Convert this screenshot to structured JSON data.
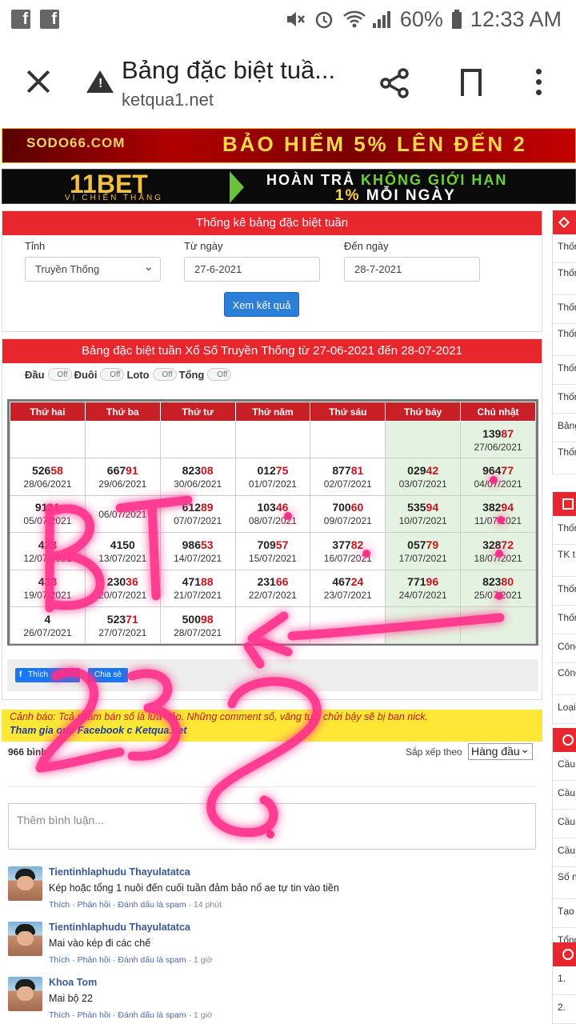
{
  "status_bar": {
    "fb_icon": "f",
    "battery": "60%",
    "time": "12:33 AM"
  },
  "browser": {
    "title": "Bảng đặc biệt tuầ...",
    "url": "ketqua1.net"
  },
  "banners": {
    "b1_logo": "SODO66.COM",
    "b1_text": "BẢO HIỂM 5% LÊN ĐẾN 2",
    "b2_logo": "11BET",
    "b2_sub": "VỊ CHIẾN THẮNG",
    "b2_line1a": "HOÀN TRẢ",
    "b2_line1b": "KHÔNG GIỚI HẠN",
    "b2_line2a": "1%",
    "b2_line2b": "MỖI NGÀY"
  },
  "filter": {
    "heading": "Thống kê bảng đặc biệt tuần",
    "province_label": "Tỉnh",
    "province_value": "Truyền Thống",
    "from_label": "Từ ngày",
    "from_value": "27-6-2021",
    "to_label": "Đến ngày",
    "to_value": "28-7-2021",
    "submit": "Xem kết quả"
  },
  "results": {
    "heading": "Bảng đặc biệt tuần Xổ Số Truyền Thống từ 27-06-2021 đến 28-07-2021",
    "toggles": [
      {
        "label": "Đầu",
        "state": "Off"
      },
      {
        "label": "Đuôi",
        "state": "Off"
      },
      {
        "label": "Loto",
        "state": "Off"
      },
      {
        "label": "Tổng",
        "state": "Off"
      }
    ],
    "days": [
      "Thứ hai",
      "Thứ ba",
      "Thứ tư",
      "Thứ năm",
      "Thứ sáu",
      "Thứ bảy",
      "Chủ nhật"
    ],
    "rows": [
      [
        null,
        null,
        null,
        null,
        null,
        null,
        {
          "p": "139",
          "s": "87",
          "d": "27/06/2021"
        }
      ],
      [
        {
          "p": "526",
          "s": "58",
          "d": "28/06/2021"
        },
        {
          "p": "667",
          "s": "91",
          "d": "29/06/2021"
        },
        {
          "p": "823",
          "s": "08",
          "d": "30/06/2021"
        },
        {
          "p": "012",
          "s": "75",
          "d": "01/07/2021"
        },
        {
          "p": "877",
          "s": "81",
          "d": "02/07/2021"
        },
        {
          "p": "029",
          "s": "42",
          "d": "03/07/2021"
        },
        {
          "p": "964",
          "s": "77",
          "d": "04/07/2021"
        }
      ],
      [
        {
          "p": "91",
          "s": "21",
          "d": "05/07/2021"
        },
        {
          "p": "",
          "s": "",
          "d": "06/07/2021"
        },
        {
          "p": "612",
          "s": "89",
          "d": "07/07/2021"
        },
        {
          "p": "103",
          "s": "46",
          "d": "08/07/2021"
        },
        {
          "p": "700",
          "s": "60",
          "d": "09/07/2021"
        },
        {
          "p": "535",
          "s": "94",
          "d": "10/07/2021"
        },
        {
          "p": "382",
          "s": "94",
          "d": "11/07/2021"
        }
      ],
      [
        {
          "p": "4",
          "s": "23",
          "d": "12/07/2021"
        },
        {
          "p": "4150",
          "s": "",
          "d": "13/07/2021"
        },
        {
          "p": "986",
          "s": "53",
          "d": "14/07/2021"
        },
        {
          "p": "709",
          "s": "57",
          "d": "15/07/2021"
        },
        {
          "p": "377",
          "s": "82",
          "d": "16/07/2021"
        },
        {
          "p": "057",
          "s": "79",
          "d": "17/07/2021"
        },
        {
          "p": "328",
          "s": "72",
          "d": "18/07/2021"
        }
      ],
      [
        {
          "p": "4",
          "s": "33",
          "d": "19/07/2021"
        },
        {
          "p": "230",
          "s": "36",
          "d": "20/07/2021"
        },
        {
          "p": "471",
          "s": "88",
          "d": "21/07/2021"
        },
        {
          "p": "231",
          "s": "66",
          "d": "22/07/2021"
        },
        {
          "p": "467",
          "s": "24",
          "d": "23/07/2021"
        },
        {
          "p": "771",
          "s": "96",
          "d": "24/07/2021"
        },
        {
          "p": "823",
          "s": "80",
          "d": "25/07/2021"
        }
      ],
      [
        {
          "p": "4",
          "s": "",
          "d": "26/07/2021"
        },
        {
          "p": "523",
          "s": "71",
          "d": "27/07/2021"
        },
        {
          "p": "500",
          "s": "98",
          "d": "28/07/2021"
        },
        null,
        null,
        null,
        null
      ]
    ],
    "like_label": "Thích",
    "share_label": "Chia sẻ"
  },
  "warning": {
    "prefix": "Cảnh báo:",
    "text_a": "T",
    "text_b": "cả spam bán số",
    "text_c": "là lừa đảo. Những comment",
    "text_d": "số, văng tục, chửi bậy sẽ bị ban nick.",
    "join": "Tham gia",
    "join_rest": "oup Facebook c",
    "site": "Ketqua.net"
  },
  "comments": {
    "count": "966 bình",
    "sort_label": "Sắp xếp theo",
    "sort_value": "Hàng đầu",
    "placeholder": "Thêm bình luận...",
    "items": [
      {
        "name": "Tientinhlaphudu Thayulatatca",
        "text": "Kép hoặc tổng 1 nuôi đến cuối tuần đảm bảo nổ ae tự tin vào tiền",
        "like": "Thích",
        "reply": "Phản hồi",
        "spam": "Đánh dấu là spam",
        "time": "14 phút"
      },
      {
        "name": "Tientinhlaphudu Thayulatatca",
        "text": "Mai vào kép đi các chế",
        "like": "Thích",
        "reply": "Phản hồi",
        "spam": "Đánh dấu là spam",
        "time": "1 giờ"
      },
      {
        "name": "Khoa Tom",
        "text": "Mai bộ 22",
        "like": "Thích",
        "reply": "Phản hồi",
        "spam": "Đánh dấu là spam",
        "time": "1 giờ"
      }
    ]
  },
  "sidebar": {
    "group1": [
      "Thống",
      "Thống loto",
      "Thống",
      "Thống loto",
      "Thống",
      "Thống",
      "Bảng",
      "Thống theo"
    ],
    "group2": [
      "Thống",
      "TK t",
      "Thống",
      "Thống",
      "Công",
      "Công VIP",
      "Loại"
    ],
    "group3": [
      "Cầu",
      "Cầu",
      "Cầu",
      "Cầu",
      "Số n",
      "Tạo",
      "Tổng"
    ],
    "group4": [
      "1.",
      "2."
    ]
  },
  "handwriting": {
    "l1": "BT",
    "l2": "23",
    "l3": "2",
    "l4": "?"
  },
  "colors": {
    "accent_red": "#e8262d",
    "header_red": "#c91f27",
    "weekend_green": "#e3f3df",
    "button_blue": "#2c7fd6",
    "ink_pink": "#ff2d8a"
  }
}
